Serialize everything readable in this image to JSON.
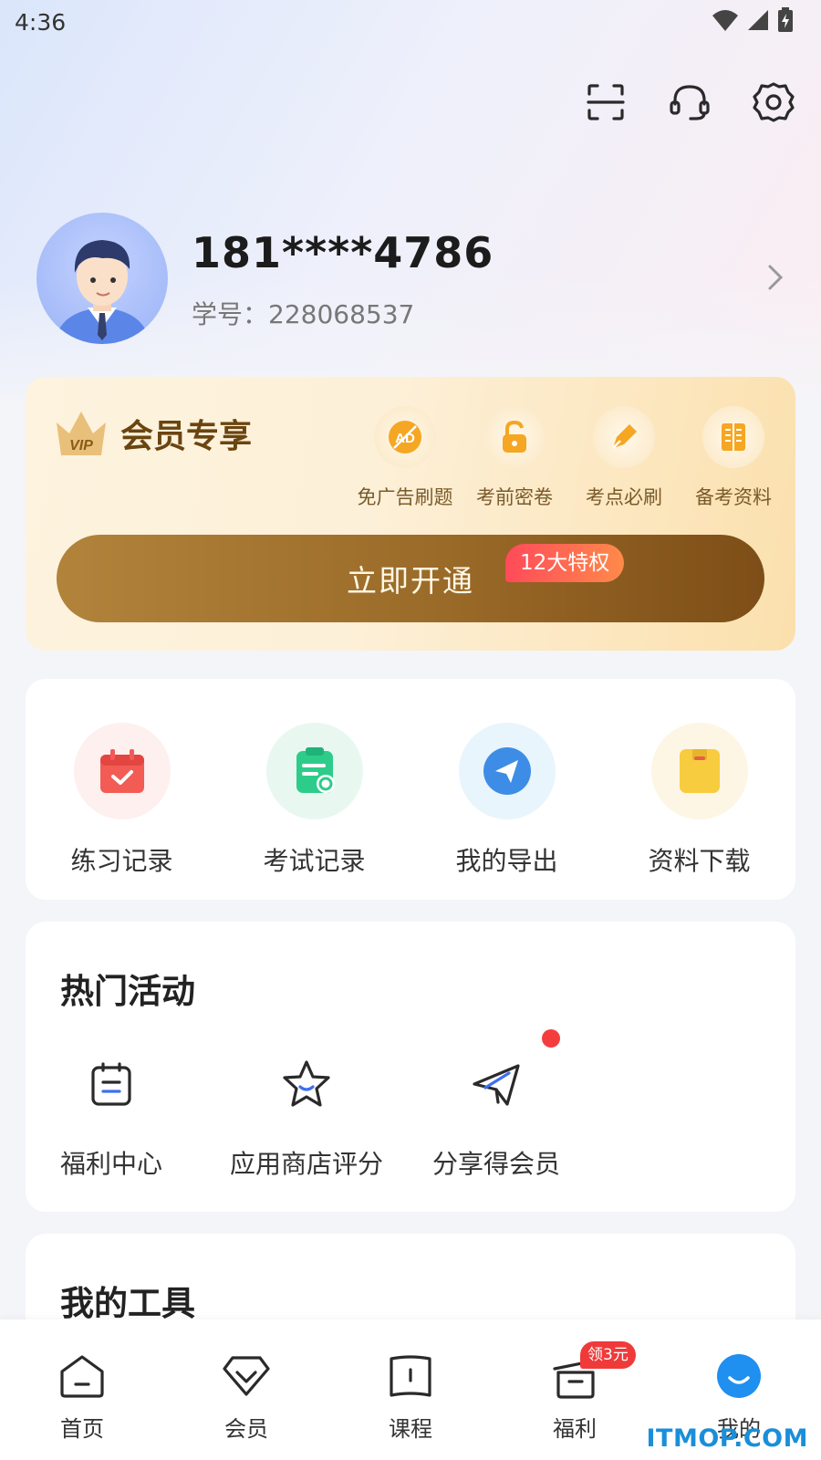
{
  "status_bar": {
    "time": "4:36"
  },
  "profile": {
    "phone": "181****4786",
    "student_id": "学号：228068537"
  },
  "vip": {
    "title": "会员专享",
    "crown_text": "VIP",
    "perks": [
      {
        "label": "免广告刷题",
        "icon": "ad-free-icon"
      },
      {
        "label": "考前密卷",
        "icon": "unlock-icon"
      },
      {
        "label": "考点必刷",
        "icon": "pen-icon"
      },
      {
        "label": "备考资料",
        "icon": "book-icon"
      }
    ],
    "button_label": "立即开通",
    "badge": "12大特权",
    "colors": {
      "button": "#9a6a28",
      "badge": "#ff4a5a"
    }
  },
  "records": [
    {
      "label": "练习记录",
      "icon": "calendar-check-icon"
    },
    {
      "label": "考试记录",
      "icon": "clipboard-icon"
    },
    {
      "label": "我的导出",
      "icon": "send-icon"
    },
    {
      "label": "资料下载",
      "icon": "folder-icon"
    }
  ],
  "activities": {
    "title": "热门活动",
    "items": [
      {
        "label": "福利中心",
        "icon": "clipboard-outline-icon"
      },
      {
        "label": "应用商店评分",
        "icon": "star-icon"
      },
      {
        "label": "分享得会员",
        "icon": "paper-plane-icon"
      }
    ]
  },
  "tools": {
    "title": "我的工具"
  },
  "nav": {
    "items": [
      {
        "label": "首页",
        "icon": "home-icon"
      },
      {
        "label": "会员",
        "icon": "diamond-icon"
      },
      {
        "label": "课程",
        "icon": "book-open-icon"
      },
      {
        "label": "福利",
        "icon": "gift-icon",
        "badge": "领3元"
      },
      {
        "label": "我的",
        "icon": "profile-icon",
        "active": true
      }
    ],
    "active_color": "#1f8ff0"
  },
  "watermark": "ITMOP.COM"
}
